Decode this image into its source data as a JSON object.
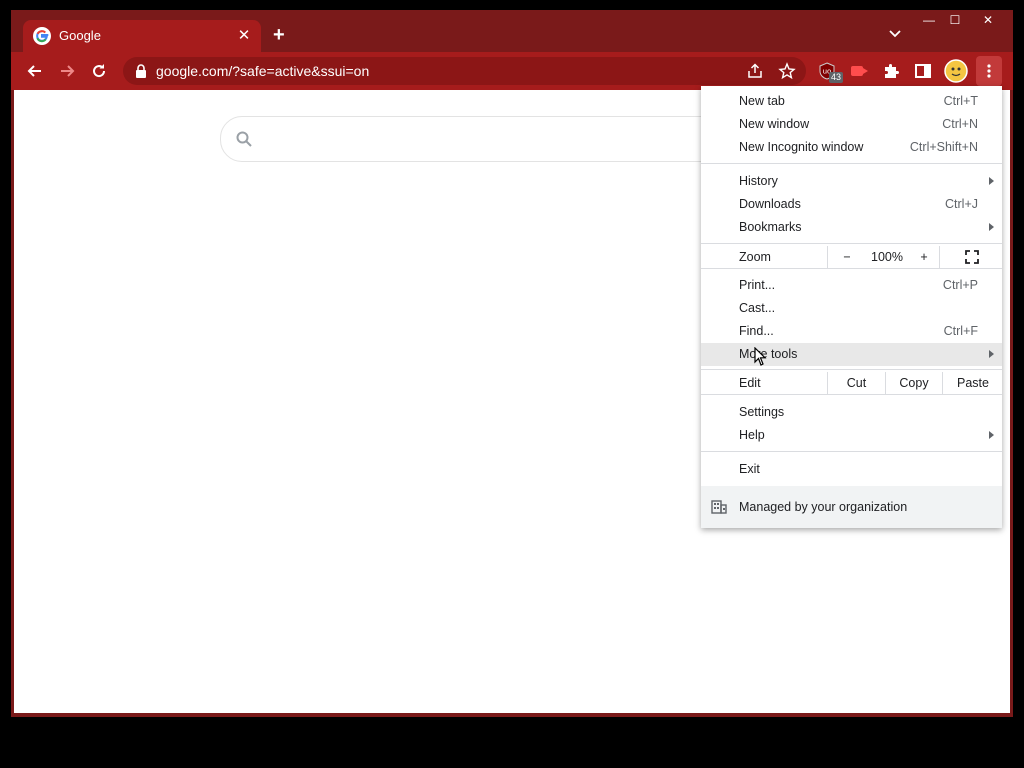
{
  "browser": {
    "tab": {
      "title": "Google"
    },
    "window_controls": {
      "minimize": "—",
      "maximize": "☐",
      "close": "✕"
    },
    "address_bar": {
      "url": "google.com/?safe=active&ssui=on"
    },
    "extensions": {
      "ublock_label": "uo",
      "ublock_badge": "43"
    },
    "icons": [
      "google-favicon",
      "close-icon",
      "plus-icon",
      "tab-search-icon",
      "back-icon",
      "forward-icon",
      "reload-icon",
      "lock-icon",
      "share-icon",
      "star-icon",
      "ublock-icon",
      "cast-icon",
      "puzzle-icon",
      "side-panel-icon",
      "avatar",
      "kebab-menu-icon"
    ]
  },
  "page": {
    "search_box": {
      "icon": "search-icon"
    }
  },
  "menu": {
    "group1": [
      {
        "label": "New tab",
        "shortcut": "Ctrl+T"
      },
      {
        "label": "New window",
        "shortcut": "Ctrl+N"
      },
      {
        "label": "New Incognito window",
        "shortcut": "Ctrl+Shift+N"
      }
    ],
    "group2": [
      {
        "label": "History",
        "shortcut": ""
      },
      {
        "label": "Downloads",
        "shortcut": "Ctrl+J"
      },
      {
        "label": "Bookmarks",
        "shortcut": ""
      }
    ],
    "zoom": {
      "label": "Zoom",
      "minus": "−",
      "value": "100%",
      "plus": "+"
    },
    "group3": [
      {
        "label": "Print...",
        "shortcut": "Ctrl+P"
      },
      {
        "label": "Cast...",
        "shortcut": ""
      },
      {
        "label": "Find...",
        "shortcut": "Ctrl+F"
      },
      {
        "label": "More tools",
        "shortcut": ""
      }
    ],
    "edit": {
      "label": "Edit",
      "cut": "Cut",
      "copy": "Copy",
      "paste": "Paste"
    },
    "group4": [
      {
        "label": "Settings",
        "shortcut": ""
      },
      {
        "label": "Help",
        "shortcut": ""
      }
    ],
    "exit": {
      "label": "Exit"
    },
    "managed": {
      "label": "Managed by your organization"
    }
  },
  "colors": {
    "frame": "#7a1a1a",
    "toolbar": "#a61c1c",
    "omnibox": "#8c1616",
    "menu_hover": "#e8e8e8"
  }
}
